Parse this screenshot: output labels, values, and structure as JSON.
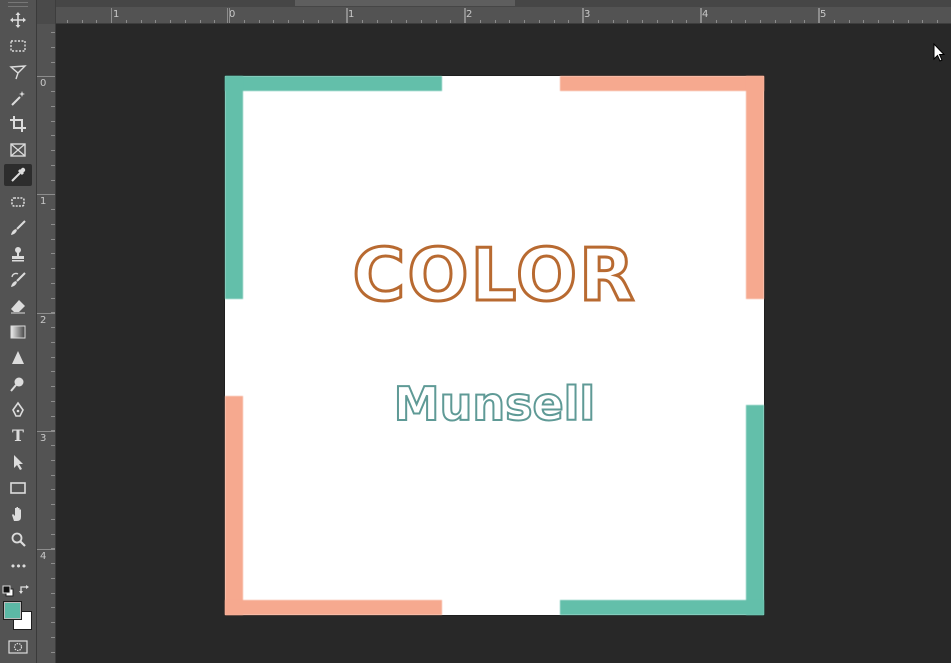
{
  "toolbar": {
    "tools": [
      {
        "name": "move-tool",
        "icon": "move-icon"
      },
      {
        "name": "rectangular-marquee-tool",
        "icon": "marquee-icon"
      },
      {
        "name": "lasso-tool",
        "icon": "lasso-icon"
      },
      {
        "name": "magic-wand-tool",
        "icon": "magic-wand-icon"
      },
      {
        "name": "crop-tool",
        "icon": "crop-icon"
      },
      {
        "name": "frame-tool",
        "icon": "frame-icon"
      },
      {
        "name": "eyedropper-tool",
        "icon": "eyedropper-icon",
        "active": true
      },
      {
        "name": "spot-healing-tool",
        "icon": "healing-icon"
      },
      {
        "name": "brush-tool",
        "icon": "brush-icon"
      },
      {
        "name": "clone-stamp-tool",
        "icon": "stamp-icon"
      },
      {
        "name": "history-brush-tool",
        "icon": "history-brush-icon"
      },
      {
        "name": "eraser-tool",
        "icon": "eraser-icon"
      },
      {
        "name": "gradient-tool",
        "icon": "gradient-icon"
      },
      {
        "name": "blur-tool",
        "icon": "blur-icon"
      },
      {
        "name": "dodge-tool",
        "icon": "dodge-icon"
      },
      {
        "name": "pen-tool",
        "icon": "pen-icon"
      },
      {
        "name": "type-tool",
        "icon": "type-icon",
        "glyph": "T"
      },
      {
        "name": "path-selection-tool",
        "icon": "arrow-icon"
      },
      {
        "name": "rectangle-tool",
        "icon": "rectangle-icon"
      },
      {
        "name": "hand-tool",
        "icon": "hand-icon"
      },
      {
        "name": "zoom-tool",
        "icon": "zoom-icon"
      },
      {
        "name": "edit-toolbar",
        "icon": "more-icon",
        "glyph": "•••"
      }
    ],
    "foreground_color": "#5cb8a5",
    "background_color": "#ffffff"
  },
  "rulers": {
    "top_labels": [
      "1",
      "0",
      "1",
      "2",
      "3",
      "4",
      "5"
    ],
    "left_labels": [
      "0",
      "1",
      "2",
      "3",
      "4"
    ]
  },
  "document": {
    "title": "COLOR",
    "subtitle": "Munsell",
    "colors": {
      "teal": "#63bfaa",
      "salmon": "#f6a98f",
      "title_color": "#b86a31",
      "subtitle_color": "#5f9a96",
      "background": "#ffffff"
    }
  }
}
